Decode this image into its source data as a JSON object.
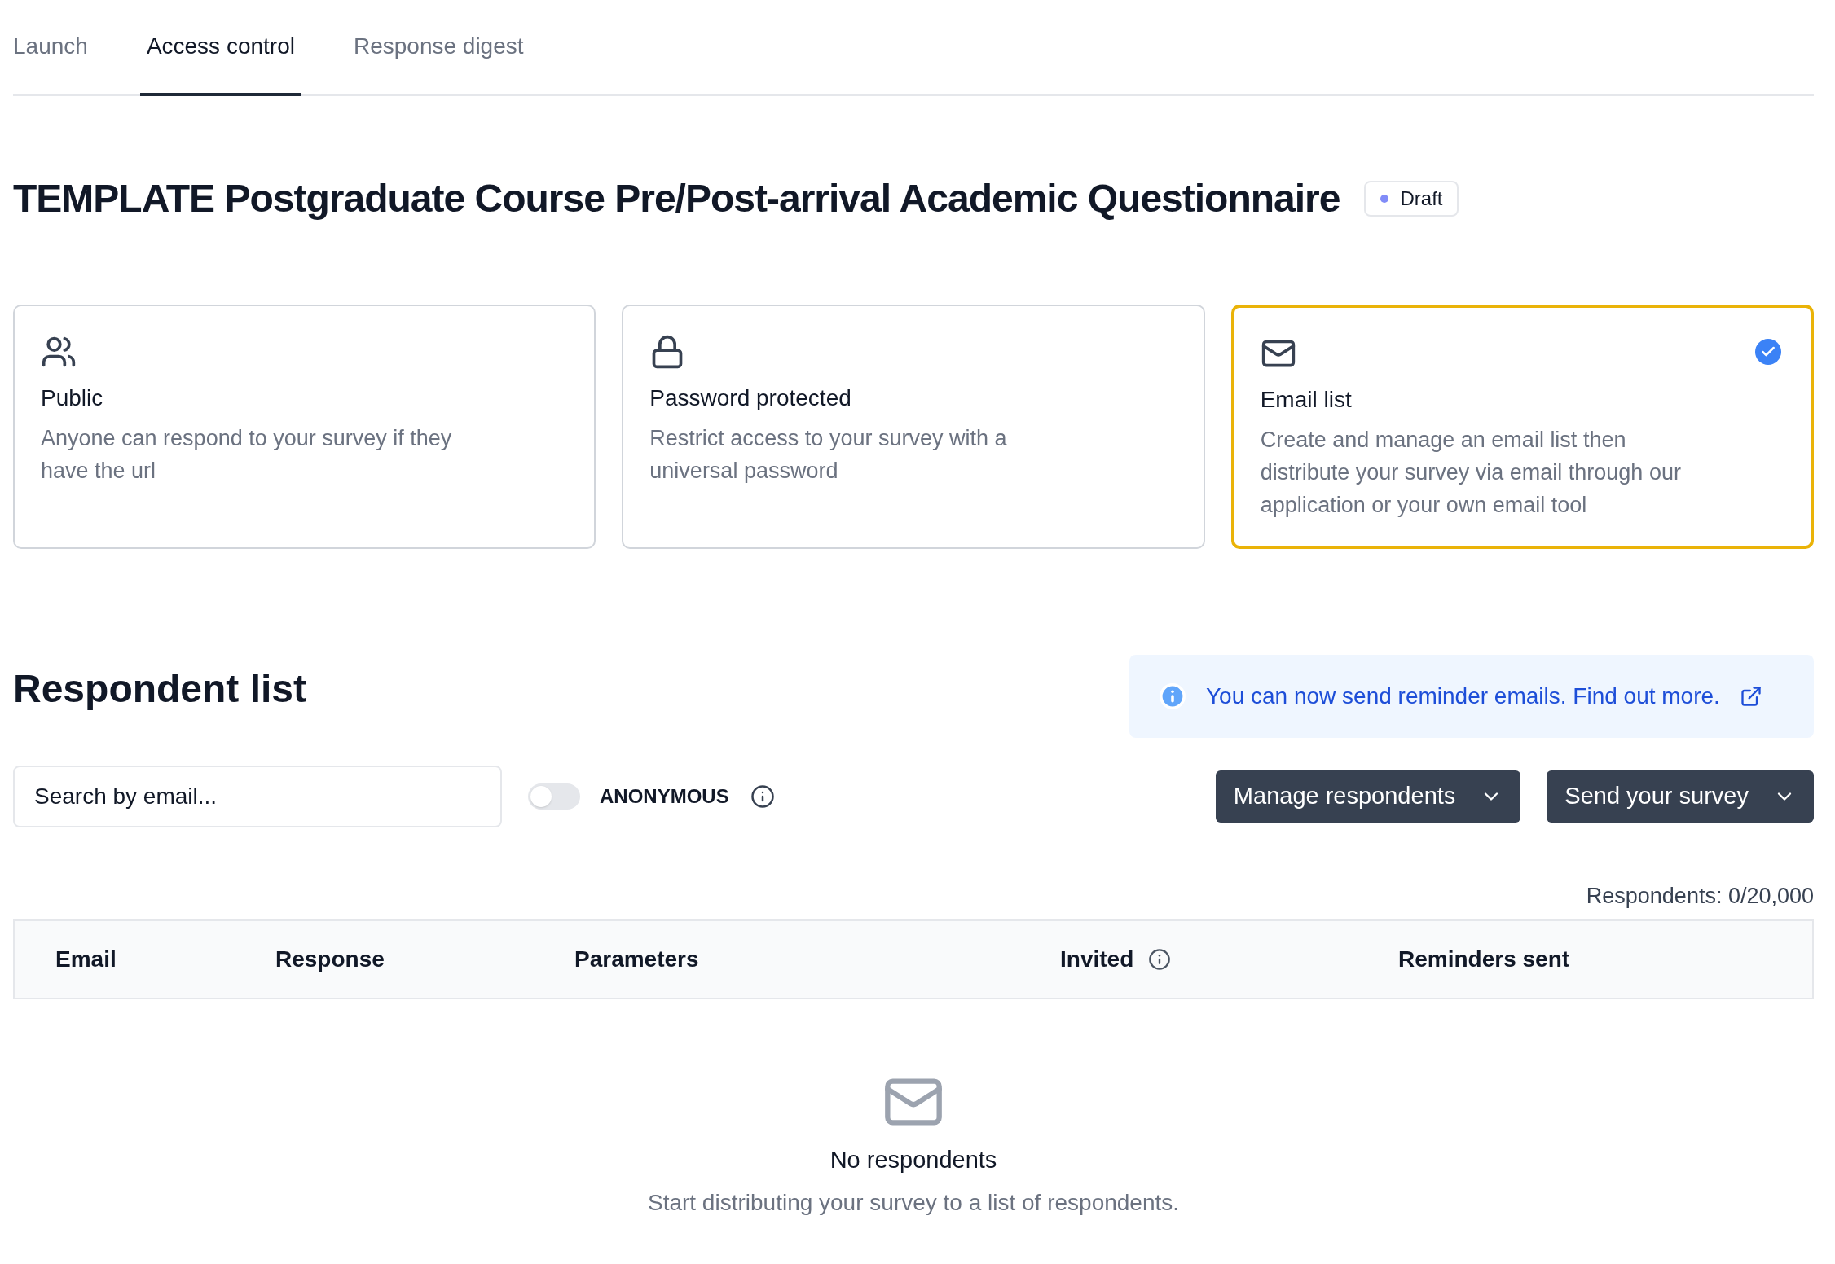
{
  "tabs": [
    {
      "label": "Launch",
      "selected": false
    },
    {
      "label": "Access control",
      "selected": true
    },
    {
      "label": "Response digest",
      "selected": false
    }
  ],
  "title": "TEMPLATE Postgraduate Course Pre/Post-arrival Academic Questionnaire",
  "status_badge": "Draft",
  "access_options": [
    {
      "kind": "public",
      "title": "Public",
      "description": "Anyone can respond to your survey if they have the url",
      "selected": false
    },
    {
      "kind": "password",
      "title": "Password protected",
      "description": "Restrict access to your survey with a universal password",
      "selected": false
    },
    {
      "kind": "email",
      "title": "Email list",
      "description": "Create and manage an email list then distribute your survey via email through our application or your own email tool",
      "selected": true
    }
  ],
  "respondent_list": {
    "heading": "Respondent list",
    "info_banner": "You can now send reminder emails. Find out more.",
    "search": {
      "placeholder": "Search by email..."
    },
    "anonymous": {
      "label": "ANONYMOUS",
      "on": false
    },
    "buttons": [
      "Manage respondents",
      "Send your survey"
    ],
    "count": "Respondents: 0/20,000",
    "table": {
      "columns": [
        {
          "label": "Email",
          "kind": "plain"
        },
        {
          "label": "Response",
          "kind": "plain"
        },
        {
          "label": "Parameters",
          "kind": "plain"
        },
        {
          "label": "Invited",
          "kind": "with_info"
        },
        {
          "label": "Reminders sent",
          "kind": "plain"
        }
      ]
    },
    "empty_state": {
      "title": "No respondents",
      "message": "Start distributing your survey to a list of respondents."
    }
  }
}
